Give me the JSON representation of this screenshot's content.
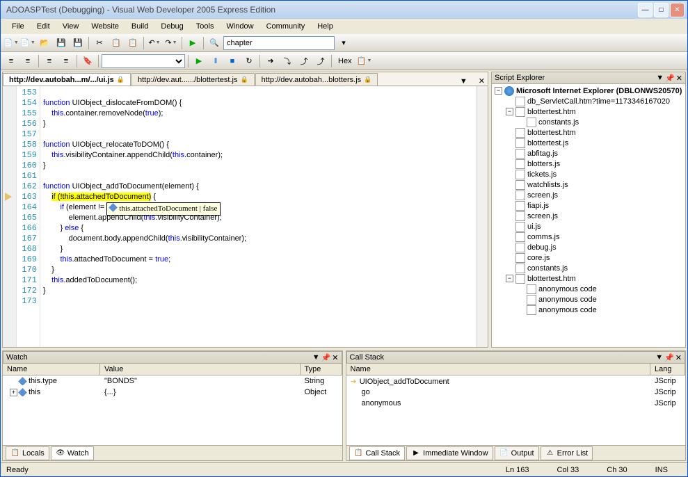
{
  "title": "ADOASPTest (Debugging) - Visual Web Developer 2005 Express Edition",
  "menus": [
    "File",
    "Edit",
    "View",
    "Website",
    "Build",
    "Debug",
    "Tools",
    "Window",
    "Community",
    "Help"
  ],
  "toolbar_combo": "chapter",
  "hex_label": "Hex",
  "tabs": [
    {
      "label": "http://dev.autobah...m/.../ui.js",
      "active": true
    },
    {
      "label": "http://dev.aut....../blottertest.js",
      "active": false
    },
    {
      "label": "http://dev.autobah...blotters.js",
      "active": false
    }
  ],
  "line_start": 153,
  "code_lines": [
    "",
    "function UIObject_dislocateFromDOM() {",
    "    this.container.removeNode(true);",
    "}",
    "",
    "function UIObject_relocateToDOM() {",
    "    this.visibilityContainer.appendChild(this.container);",
    "}",
    "",
    "function UIObject_addToDocument(element) {",
    "    if (!this.attachedToDocument) {",
    "        if (element !=",
    "            element.appendChild(this.visibilityContainer);",
    "        } else {",
    "            document.body.appendChild(this.visibilityContainer);",
    "        }",
    "        this.attachedToDocument = true;",
    "    }",
    "    this.addedToDocument();",
    "}",
    ""
  ],
  "breakpoint_line": 163,
  "tooltip": "this.attachedToDocument | false",
  "script_explorer": {
    "title": "Script Explorer",
    "root": "Microsoft Internet Explorer (DBLONWS20570)",
    "items": [
      {
        "level": 2,
        "type": "page",
        "label": "db_ServletCall.htm?time=1173346167020"
      },
      {
        "level": 2,
        "type": "page",
        "label": "blottertest.htm",
        "expanded": true
      },
      {
        "level": 3,
        "type": "js",
        "label": "constants.js"
      },
      {
        "level": 2,
        "type": "page",
        "label": "blottertest.htm"
      },
      {
        "level": 2,
        "type": "js",
        "label": "blottertest.js"
      },
      {
        "level": 2,
        "type": "js",
        "label": "abfitag.js"
      },
      {
        "level": 2,
        "type": "js",
        "label": "blotters.js"
      },
      {
        "level": 2,
        "type": "js",
        "label": "tickets.js"
      },
      {
        "level": 2,
        "type": "js",
        "label": "watchlists.js"
      },
      {
        "level": 2,
        "type": "js",
        "label": "screen.js"
      },
      {
        "level": 2,
        "type": "js",
        "label": "fiapi.js"
      },
      {
        "level": 2,
        "type": "js",
        "label": "screen.js"
      },
      {
        "level": 2,
        "type": "js",
        "label": "ui.js"
      },
      {
        "level": 2,
        "type": "js",
        "label": "comms.js"
      },
      {
        "level": 2,
        "type": "js",
        "label": "debug.js"
      },
      {
        "level": 2,
        "type": "js",
        "label": "core.js"
      },
      {
        "level": 2,
        "type": "js",
        "label": "constants.js"
      },
      {
        "level": 2,
        "type": "page",
        "label": "blottertest.htm",
        "expanded": true
      },
      {
        "level": 3,
        "type": "js",
        "label": "anonymous code"
      },
      {
        "level": 3,
        "type": "js",
        "label": "anonymous code"
      },
      {
        "level": 3,
        "type": "js",
        "label": "anonymous code"
      }
    ]
  },
  "watch": {
    "title": "Watch",
    "columns": [
      "Name",
      "Value",
      "Type"
    ],
    "rows": [
      {
        "name": "this.type",
        "value": "\"BONDS\"",
        "type": "String"
      },
      {
        "name": "this",
        "value": "{...}",
        "type": "Object",
        "expandable": true
      }
    ],
    "tabs": [
      "Locals",
      "Watch"
    ]
  },
  "callstack": {
    "title": "Call Stack",
    "columns": [
      "Name",
      "Lang"
    ],
    "rows": [
      {
        "name": "UIObject_addToDocument",
        "lang": "JScrip",
        "current": true
      },
      {
        "name": "go",
        "lang": "JScrip"
      },
      {
        "name": "anonymous",
        "lang": "JScrip"
      }
    ],
    "tabs": [
      "Call Stack",
      "Immediate Window",
      "Output",
      "Error List"
    ]
  },
  "status": {
    "ready": "Ready",
    "ln": "Ln 163",
    "col": "Col 33",
    "ch": "Ch 30",
    "ins": "INS"
  }
}
